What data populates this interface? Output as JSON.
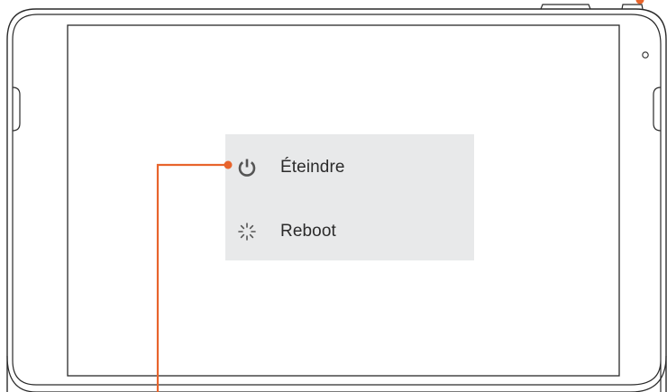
{
  "power_menu": {
    "items": [
      {
        "label": "Éteindre",
        "icon": "power-icon"
      },
      {
        "label": "Reboot",
        "icon": "spinner-icon"
      }
    ]
  },
  "colors": {
    "device_outline": "#2a2a2a",
    "menu_background": "#e8e9ea",
    "icon": "#555555",
    "callout": "#e8642c"
  }
}
